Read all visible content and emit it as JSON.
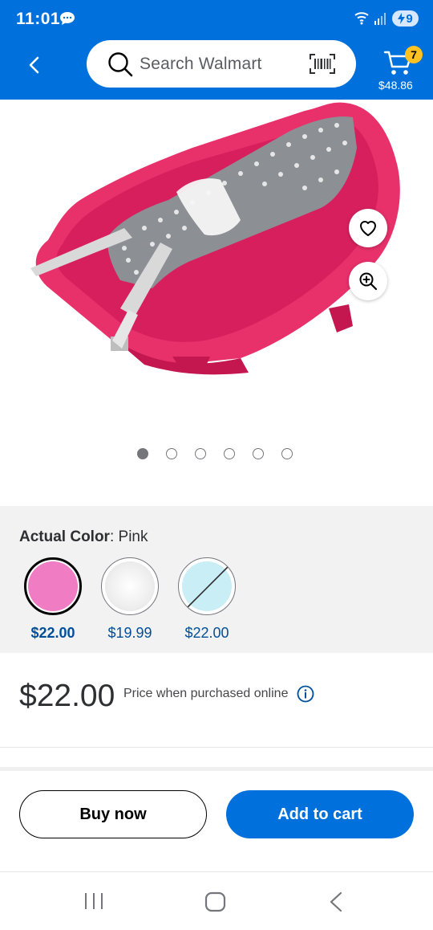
{
  "status_bar": {
    "time": "11:01",
    "battery": "9"
  },
  "header": {
    "search_placeholder": "Search Walmart",
    "cart_count": "7",
    "cart_total": "$48.86",
    "brand_color": "#0071dc"
  },
  "gallery": {
    "image_count": 6,
    "active_index": 0
  },
  "variants": {
    "label_bold": "Actual Color",
    "label_sep": ": ",
    "selected_value": "Pink",
    "options": [
      {
        "name": "Pink",
        "price": "$22.00",
        "color": "#f07cc4",
        "selected": true
      },
      {
        "name": "White",
        "price": "$19.99",
        "color": "#f4f4f4",
        "selected": false
      },
      {
        "name": "Light Blue",
        "price": "$22.00",
        "color": "#c9eef6",
        "selected": false,
        "unavailable": true
      }
    ]
  },
  "price": {
    "amount": "$22.00",
    "note": "Price when purchased online"
  },
  "actions": {
    "buy_now": "Buy now",
    "add_to_cart": "Add to cart"
  }
}
